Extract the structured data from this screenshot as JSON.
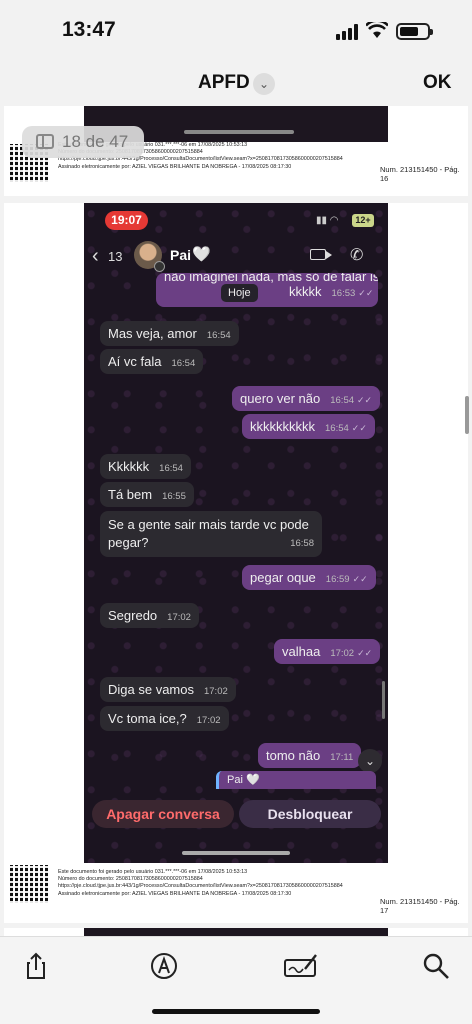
{
  "status_bar": {
    "time": "13:47"
  },
  "nav": {
    "title": "APFD",
    "done_label": "OK"
  },
  "page_indicator": "18 de 47",
  "doc_footer_top": {
    "lines": [
      "Este documento foi gerado pelo usuário 031.***.***-06 em 17/08/2025 10:53:13",
      "Número do documento: 25081708173058600000207515884",
      "https://pje.cloud.tjpe.jus.br:443/1g/Processo/ConsultaDocumento/listView.seam?x=25081708173058600000207515884",
      "Assinado eletronicamente por: AZIEL VIEGAS BRILHANTE DA NOBREGA - 17/08/2025 08:17:30"
    ],
    "page_num": "Num. 213151450 - Pág. 16"
  },
  "doc_footer_bottom": {
    "lines": [
      "Este documento foi gerado pelo usuário 031.***.***-06 em 17/08/2025 10:53:13",
      "Número do documento: 25081708173058600000207515884",
      "https://pje.cloud.tjpe.jus.br:443/1g/Processo/ConsultaDocumento/listView.seam?x=25081708173058600000207515884",
      "Assinado eletronicamente por: AZIEL VIEGAS BRILHANTE DA NOBREGA - 17/08/2025 08:17:30"
    ],
    "page_num": "Num. 213151450 - Pág. 17"
  },
  "phone": {
    "time": "19:07",
    "battery": "12+",
    "back_count": "13",
    "contact": "Pai",
    "heart": "🤍",
    "date_chip": "Hoje",
    "messages": [
      {
        "dir": "out",
        "text": "não imaginei nada, mas só de falar isso n quis",
        "extra": "kkkkk",
        "time": "16:53"
      },
      {
        "dir": "in",
        "text": "Mas veja, amor",
        "time": "16:54"
      },
      {
        "dir": "in",
        "text": "Aí vc fala",
        "time": "16:54"
      },
      {
        "dir": "out",
        "text": "quero ver não",
        "time": "16:54"
      },
      {
        "dir": "out",
        "text": "kkkkkkkkkk",
        "time": "16:54"
      },
      {
        "dir": "in",
        "text": "Kkkkkk",
        "time": "16:54"
      },
      {
        "dir": "in",
        "text": "Tá bem",
        "time": "16:55"
      },
      {
        "dir": "in",
        "text": "Se a gente sair mais tarde vc pode pegar?",
        "time": "16:58"
      },
      {
        "dir": "out",
        "text": "pegar oque",
        "time": "16:59"
      },
      {
        "dir": "in",
        "text": "Segredo",
        "time": "17:02"
      },
      {
        "dir": "out",
        "text": "valhaa",
        "time": "17:02"
      },
      {
        "dir": "in",
        "text": "Diga se vamos",
        "time": "17:02"
      },
      {
        "dir": "in",
        "text": "Vc toma ice,?",
        "time": "17:02"
      },
      {
        "dir": "out",
        "text": "tomo não",
        "time": "17:11"
      }
    ],
    "quote_preview": "Pai 🤍",
    "delete_label": "Apagar conversa",
    "unblock_label": "Desbloquear"
  },
  "toolbar": {
    "icons": [
      "share-icon",
      "markup-pen-icon",
      "signature-icon",
      "search-icon"
    ]
  }
}
